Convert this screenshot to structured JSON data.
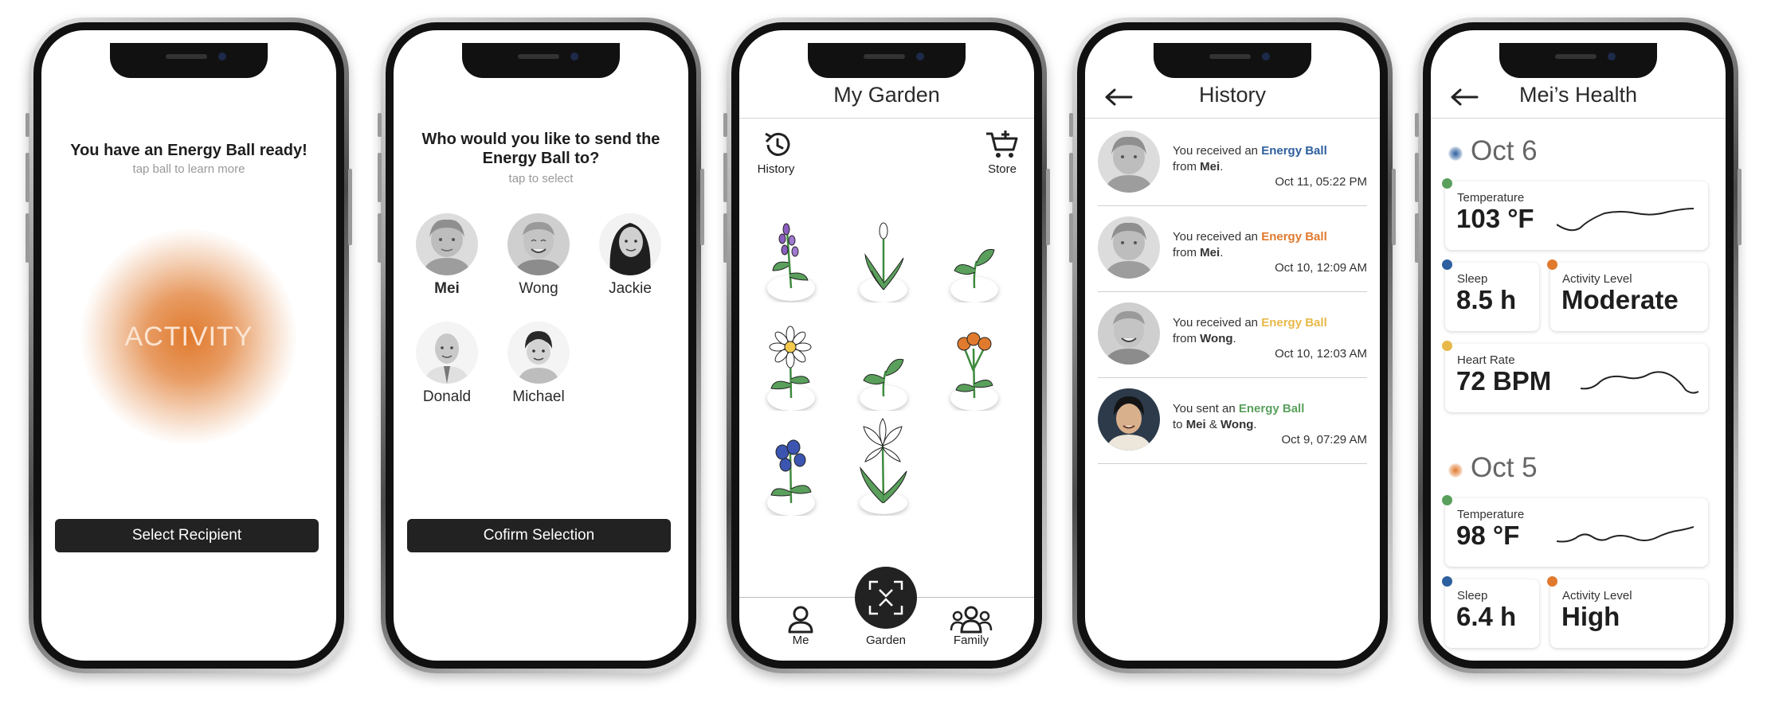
{
  "colors": {
    "blue": "#2e5f9e",
    "orange": "#e07a2e",
    "yellow": "#e8b84a",
    "green": "#5aa05c",
    "dark": "#222222"
  },
  "screen1": {
    "heading": "You have an Energy Ball ready!",
    "subheading": "tap ball to learn more",
    "ball_label": "ACTIVITY",
    "button": "Select Recipient"
  },
  "screen2": {
    "heading_line1": "Who would you like to send the",
    "heading_line2": "Energy Ball to?",
    "subheading": "tap to select",
    "people": [
      {
        "name": "Mei",
        "selected": true
      },
      {
        "name": "Wong",
        "selected": false
      },
      {
        "name": "Jackie",
        "selected": false
      },
      {
        "name": "Donald",
        "selected": false
      },
      {
        "name": "Michael",
        "selected": false
      }
    ],
    "button": "Cofirm Selection"
  },
  "screen3": {
    "title": "My Garden",
    "history_label": "History",
    "store_label": "Store",
    "tabs": [
      {
        "label": "Me",
        "icon": "person-icon"
      },
      {
        "label": "Garden",
        "icon": "garden-scan-icon"
      },
      {
        "label": "Family",
        "icon": "family-icon"
      }
    ]
  },
  "screen4": {
    "title": "History",
    "entries": [
      {
        "prefix": "You received an",
        "ball": "Energy Ball",
        "ball_color": "#2e5f9e",
        "joiner": "from",
        "who": "Mei",
        "who2": "",
        "time": "Oct 11, 05:22 PM"
      },
      {
        "prefix": "You received an",
        "ball": "Energy Ball",
        "ball_color": "#e07a2e",
        "joiner": "from",
        "who": "Mei",
        "who2": "",
        "time": "Oct 10, 12:09 AM"
      },
      {
        "prefix": "You received an",
        "ball": "Energy Ball",
        "ball_color": "#e8b84a",
        "joiner": "from",
        "who": "Wong",
        "who2": "",
        "time": "Oct 10, 12:03 AM"
      },
      {
        "prefix": "You sent an",
        "ball": "Energy Ball",
        "ball_color": "#5aa05c",
        "joiner": "to",
        "who": "Mei",
        "who2": "Wong",
        "time": "Oct 9, 07:29 AM"
      }
    ]
  },
  "screen5": {
    "title": "Mei’s Health",
    "days": [
      {
        "date": "Oct 6",
        "temperature_label": "Temperature",
        "temperature": "103 °F",
        "sleep_label": "Sleep",
        "sleep": "8.5 h",
        "activity_label": "Activity Level",
        "activity": "Moderate",
        "heart_label": "Heart Rate",
        "heart": "72 BPM"
      },
      {
        "date": "Oct 5",
        "temperature_label": "Temperature",
        "temperature": "98 °F",
        "sleep_label": "Sleep",
        "sleep": "6.4 h",
        "activity_label": "Activity Level",
        "activity": "High"
      }
    ]
  }
}
